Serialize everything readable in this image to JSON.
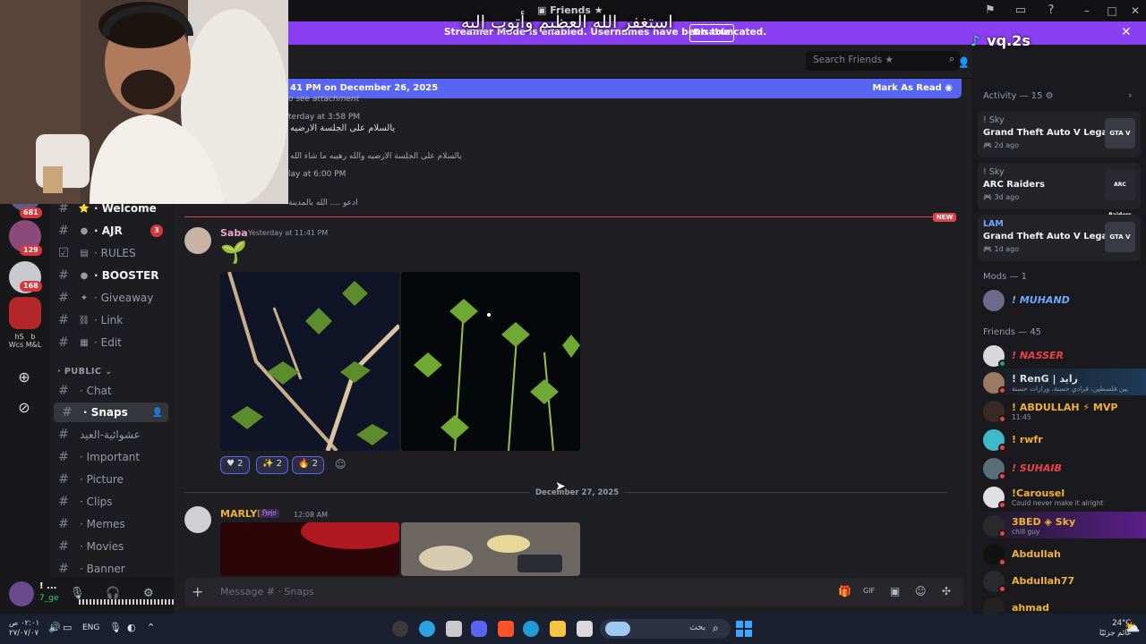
{
  "window": {
    "title": "Friends"
  },
  "banner": {
    "message": "Streamer Mode is enabled. Usernames have been truncated.",
    "disable_label": "Disable"
  },
  "overlay": {
    "arabic_caption": "استغفر الله العظيم وأتوب إليه",
    "tiktok_handle": "vq.2s"
  },
  "servers": [
    {
      "badge": "681",
      "color": "#5a5f8a"
    },
    {
      "badge": "129",
      "color": "#8a4a7a"
    },
    {
      "badge": "168",
      "color": "#c9c9d0"
    },
    {
      "badge": "",
      "color": "#b3262a"
    }
  ],
  "server_folder_label": "hS  b\nWcs M&L",
  "channels": [
    {
      "icon": "⭐",
      "label": "· Welcome",
      "bold": true,
      "arrow": true
    },
    {
      "icon": "●",
      "label": "· AJR",
      "bold": true,
      "arrow": true,
      "badge": "3"
    },
    {
      "icon": "▤",
      "label": "· RULES",
      "bold": false,
      "arrow": true
    },
    {
      "icon": "●",
      "label": "· BOOSTER",
      "bold": true,
      "arrow": true
    },
    {
      "icon": "✦",
      "label": "· Giveaway",
      "bold": false
    },
    {
      "icon": "⛓",
      "label": "· Link",
      "bold": false
    },
    {
      "icon": "▦",
      "label": "· Edit",
      "bold": false
    }
  ],
  "category": "PUBLIC",
  "public_channels": [
    {
      "label": "· Chat",
      "active": false
    },
    {
      "label": "· Snaps",
      "active": true
    },
    {
      "label": "عشوائية-العيد",
      "active": false
    },
    {
      "label": "· Important",
      "active": false
    },
    {
      "label": "· Picture",
      "active": false
    },
    {
      "label": "· Clips",
      "active": false
    },
    {
      "label": "· Memes",
      "active": false
    },
    {
      "label": "· Movies",
      "active": false
    },
    {
      "label": "· Banner",
      "active": false
    }
  ],
  "user": {
    "name": "! ...",
    "status": "7_ge"
  },
  "new_messages_bar": {
    "since": "41 PM on December 26, 2025",
    "mark_read": "Mark As Read"
  },
  "older": {
    "attachment": "o see attachment",
    "stamp1": "terday at 3:58 PM",
    "reply1": "يالسلام على الجلسة الارضيه",
    "reply2": "يالسلام على الجلسة الارضيه والله رهيبه ما شاء الله",
    "stamp2": "lay at 6:00 PM",
    "reply3": "ادعو .... الله بالمدينة"
  },
  "new_label": "NEW",
  "messages": [
    {
      "author": "Saba",
      "author_color": "#e7a8c2",
      "timestamp": "Yesterday at 11:41 PM",
      "emoji": "🌱",
      "reactions": [
        {
          "emoji": "♥",
          "count": "2"
        },
        {
          "emoji": "✨",
          "count": "2"
        },
        {
          "emoji": "🔥",
          "count": "2"
        }
      ]
    },
    {
      "author": "MARLYN",
      "author_color": "#f0b232",
      "tag": "ℌ𝔬𝔧𝔬",
      "timestamp": "12:08 AM"
    }
  ],
  "date_divider": "December 27, 2025",
  "composer": {
    "placeholder": "Message # · Snaps"
  },
  "search": {
    "placeholder": "Search Friends ★"
  },
  "activity": {
    "header": "Activity — 15",
    "items": [
      {
        "user": "! Sky",
        "game": "Grand Theft Auto V Legacy",
        "time": "2d ago",
        "art": "GTA V"
      },
      {
        "user": "! Sky",
        "game": "ARC Raiders",
        "time": "3d ago",
        "art": "ARC Raiders"
      },
      {
        "user": "LAM",
        "game": "Grand Theft Auto V Legacy",
        "time": "1d ago",
        "art": "GTA V"
      }
    ]
  },
  "mods": {
    "header": "Mods — 1",
    "items": [
      {
        "name": "! MUHAND",
        "color": "#6ea8ff"
      }
    ]
  },
  "friends": {
    "header": "Friends — 45",
    "items": [
      {
        "name": "! NASSER",
        "color": "#ed4245",
        "sub": "",
        "status": "#f23f43"
      },
      {
        "name": "! RenG | رايد",
        "color": "#dbdee1",
        "sub": "بين فلسطين، قرادي حسنة، وزارات حسنة",
        "status": "#f23f43"
      },
      {
        "name": "! ABDULLAH ⚡ MVP",
        "color": "#f0b232",
        "sub": "11:45",
        "status": "#f23f43"
      },
      {
        "name": "! rwfr",
        "color": "#f0b232",
        "sub": "",
        "status": "#f23f43"
      },
      {
        "name": "! SUHAIB",
        "color": "#ed4245",
        "sub": "",
        "status": "#f23f43"
      },
      {
        "name": "!Carousel",
        "color": "#f0b232",
        "sub": "Could never make it alright",
        "status": "#f23f43"
      },
      {
        "name": "3BED ◈ Sky",
        "color": "#f0b232",
        "sub": "chill guy",
        "status": "#f23f43"
      },
      {
        "name": "Abdullah",
        "color": "#f0b232",
        "sub": "",
        "status": "#f23f43"
      },
      {
        "name": "Abdullah77",
        "color": "#f0b232",
        "sub": "",
        "status": "#f23f43"
      },
      {
        "name": "ahmad",
        "color": "#f0b232",
        "sub": "",
        "status": "#f23f43"
      }
    ]
  },
  "taskbar": {
    "time": "٠٢:٠١ ص",
    "date": "٢٧/٠٧/٠٧",
    "lang": "ENG",
    "search": "بحث",
    "weather_temp": "24°C",
    "weather_text": "غائم جزئيًا"
  }
}
